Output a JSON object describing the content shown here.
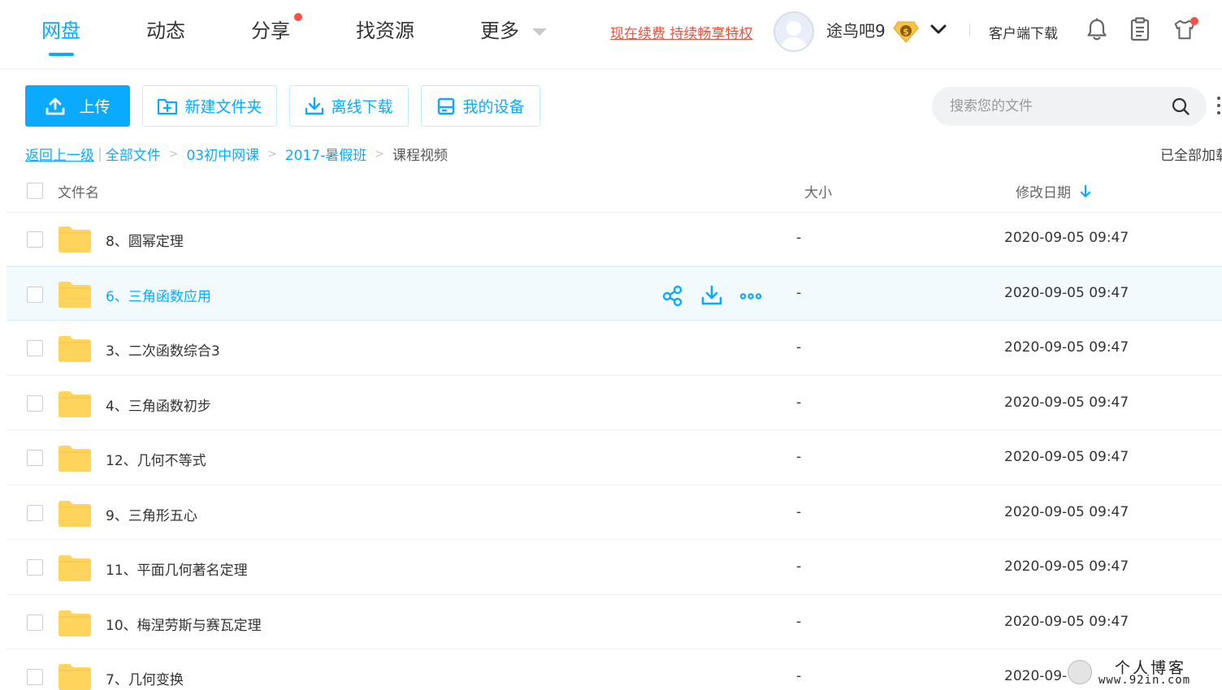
{
  "nav": {
    "tabs": [
      {
        "label": "网盘",
        "active": true
      },
      {
        "label": "动态",
        "active": false
      },
      {
        "label": "分享",
        "active": false
      },
      {
        "label": "找资源",
        "active": false
      },
      {
        "label": "更多",
        "active": false
      }
    ],
    "renew_link": "现在续费 持续畅享特权",
    "username": "途鸟吧9",
    "client_download": "客户端下载"
  },
  "toolbar": {
    "upload": "上传",
    "new_folder": "新建文件夹",
    "offline_download": "离线下载",
    "my_devices": "我的设备",
    "search_placeholder": "搜索您的文件"
  },
  "breadcrumb": {
    "back": "返回上一级",
    "items": [
      "全部文件",
      "03初中网课",
      "2017-暑假班"
    ],
    "current": "课程视频",
    "status": "已全部加载"
  },
  "table": {
    "headers": {
      "name": "文件名",
      "size": "大小",
      "date": "修改日期"
    },
    "rows": [
      {
        "name": "8、圆幂定理",
        "size": "-",
        "date": "2020-09-05 09:47"
      },
      {
        "name": "6、三角函数应用",
        "size": "-",
        "date": "2020-09-05 09:47"
      },
      {
        "name": "3、二次函数综合3",
        "size": "-",
        "date": "2020-09-05 09:47"
      },
      {
        "name": "4、三角函数初步",
        "size": "-",
        "date": "2020-09-05 09:47"
      },
      {
        "name": "12、几何不等式",
        "size": "-",
        "date": "2020-09-05 09:47"
      },
      {
        "name": "9、三角形五心",
        "size": "-",
        "date": "2020-09-05 09:47"
      },
      {
        "name": "11、平面几何著名定理",
        "size": "-",
        "date": "2020-09-05 09:47"
      },
      {
        "name": "10、梅涅劳斯与赛瓦定理",
        "size": "-",
        "date": "2020-09-05 09:47"
      },
      {
        "name": "7、几何变换",
        "size": "-",
        "date": "2020-09-"
      }
    ]
  },
  "watermark": {
    "line1": "个人博客",
    "line2": "www.92in.com"
  },
  "colors": {
    "accent": "#09AAFF",
    "renew": "#E8523F",
    "folder": "#FFD45C",
    "dot": "#F5504A"
  },
  "icons": [
    "upload-icon",
    "folder-plus-icon",
    "download-icon",
    "device-icon",
    "search-icon",
    "bell-icon",
    "clipboard-icon",
    "shirt-icon",
    "share-icon",
    "more-icon",
    "folder-icon",
    "sort-down-icon",
    "vip-diamond-icon",
    "chevron-down-icon"
  ]
}
